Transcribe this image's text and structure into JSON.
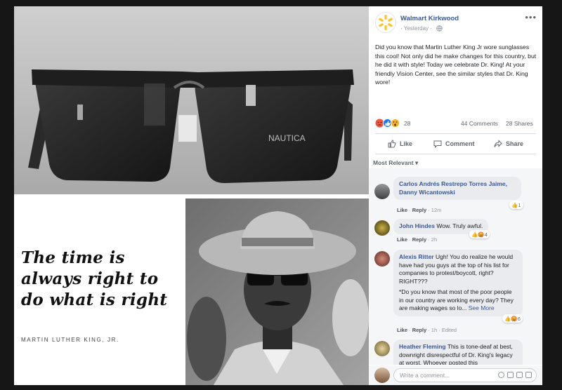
{
  "post": {
    "page_name": "Walmart Kirkwood",
    "timestamp": "Yesterday",
    "text": "Did you know that Martin Luther King Jr wore sunglasses this cool! Not only did he make changes for this country, but he did it with style! Today we celebrate Dr. King! At your friendly Vision Center, see the similar styles that Dr. King wore!",
    "reaction_count": "28",
    "comments_count": "44 Comments",
    "shares_count": "28 Shares",
    "actions": {
      "like": "Like",
      "comment": "Comment",
      "share": "Share"
    },
    "sort_label": "Most Relevant"
  },
  "image": {
    "brand_on_lens": "NAUTICA",
    "quote": "The time is always right to do what is right",
    "quote_author": "MARTIN LUTHER KING, JR."
  },
  "comments": [
    {
      "author": "Carlos Andrés Restrepo Torres",
      "text": "Jaime, Danny Wicantowski",
      "like": "Like",
      "reply": "Reply",
      "time": "12m",
      "reactions": "1"
    },
    {
      "author": "John Hindes",
      "text": "Wow. Truly awful.",
      "like": "Like",
      "reply": "Reply",
      "time": "2h",
      "reactions": "4"
    },
    {
      "author": "Alexis Ritter",
      "text": "Ugh! You do realize he would have had you guys at the top of his list for companies to protest/boycott, right? RIGHT???",
      "text2": "*Do you know that most of the poor people in our country are working every day? They are making wages so lo...",
      "see_more": "See More",
      "like": "Like",
      "reply": "Reply",
      "time": "1h",
      "edited": "Edited",
      "reactions": "6"
    },
    {
      "author": "Heather Fleming",
      "text": "This is tone-deaf at best, downright disrespectful of Dr. King's legacy at worst. Whoever posted this"
    }
  ],
  "composer": {
    "placeholder": "Write a comment..."
  },
  "colors": {
    "link": "#385898",
    "walmart_yellow": "#ffc220",
    "like_blue": "#1877f2"
  }
}
